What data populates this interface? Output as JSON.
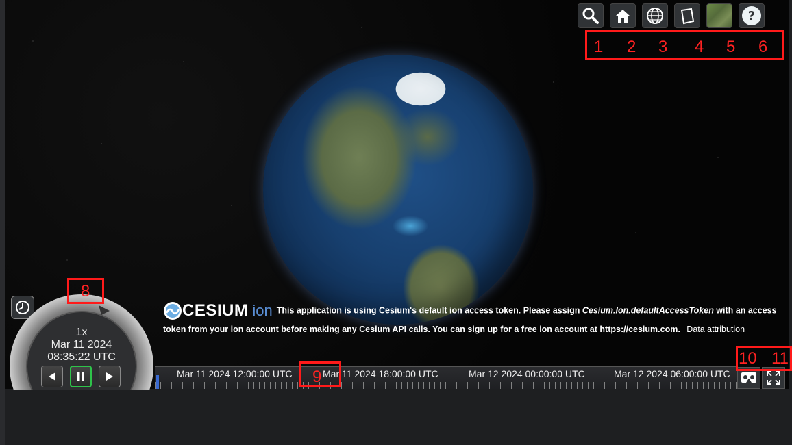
{
  "toolbar": {
    "items": [
      {
        "icon": "search-icon",
        "label": "Search"
      },
      {
        "icon": "home-icon",
        "label": "Home"
      },
      {
        "icon": "globe-icon",
        "label": "Scene mode"
      },
      {
        "icon": "cube-icon",
        "label": "3D view"
      },
      {
        "icon": "imagery-icon",
        "label": "Base layer"
      },
      {
        "icon": "help-icon",
        "label": "?"
      }
    ]
  },
  "annotations": {
    "toolbar_numbers": [
      "1",
      "2",
      "3",
      "4",
      "5",
      "6"
    ],
    "animation_label": "8",
    "timeline_label": "9",
    "vr_label": "10",
    "fullscreen_label": "11"
  },
  "animation": {
    "speed": "1x",
    "date": "Mar 11 2024",
    "time": "08:35:22 UTC",
    "playing": true
  },
  "credits": {
    "logo_text": "CESIUM",
    "logo_suffix": "ion",
    "message_part1": "This application is using Cesium's default ion access token. Please assign ",
    "token_name": "Cesium.Ion.defaultAccessToken",
    "message_part2": " with an access token from your ion account before making any Cesium API calls. You can sign up for a free ion account at ",
    "link": "https://cesium.com",
    "message_part3": ".",
    "data_attribution": "Data attribution"
  },
  "timeline": {
    "labels": [
      "Mar 11 2024 12:00:00 UTC",
      "Mar 11 2024 18:00:00 UTC",
      "Mar 12 2024 00:00:00 UTC",
      "Mar 12 2024 06:00:00 UTC"
    ]
  },
  "colors": {
    "annotation_red": "#ff1a1a",
    "button_bg": "#303336",
    "active_green": "#2ec34a"
  }
}
